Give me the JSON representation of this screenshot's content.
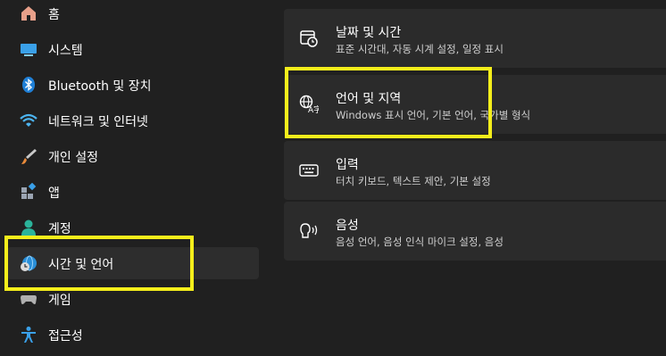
{
  "sidebar": {
    "items": [
      {
        "label": "홈",
        "icon": "home-icon"
      },
      {
        "label": "시스템",
        "icon": "system-monitor-icon"
      },
      {
        "label": "Bluetooth 및 장치",
        "icon": "bluetooth-icon"
      },
      {
        "label": "네트워크 및 인터넷",
        "icon": "wifi-icon"
      },
      {
        "label": "개인 설정",
        "icon": "paintbrush-icon"
      },
      {
        "label": "앱",
        "icon": "apps-icon"
      },
      {
        "label": "계정",
        "icon": "person-icon"
      },
      {
        "label": "시간 및 언어",
        "icon": "time-language-icon",
        "selected": true
      },
      {
        "label": "게임",
        "icon": "game-controller-icon"
      },
      {
        "label": "접근성",
        "icon": "accessibility-icon"
      }
    ]
  },
  "main": {
    "cards": [
      {
        "title": "날짜 및 시간",
        "subtitle": "표준 시간대, 자동 시계 설정, 일정 표시",
        "icon": "calendar-clock-icon"
      },
      {
        "title": "언어 및 지역",
        "subtitle": "Windows 표시 언어, 기본 언어, 국가별 형식",
        "icon": "language-region-icon"
      },
      {
        "title": "입력",
        "subtitle": "터치 키보드, 텍스트 제안, 기본 설정",
        "icon": "keyboard-icon"
      },
      {
        "title": "음성",
        "subtitle": "음성 언어, 음성 인식 마이크 설정, 음성",
        "icon": "speech-icon"
      }
    ]
  },
  "colors": {
    "background": "#202020",
    "card": "#2b2b2b",
    "selected": "#2d2d2d",
    "highlight": "#f5ee1b",
    "accent": "#4cc2ff"
  }
}
